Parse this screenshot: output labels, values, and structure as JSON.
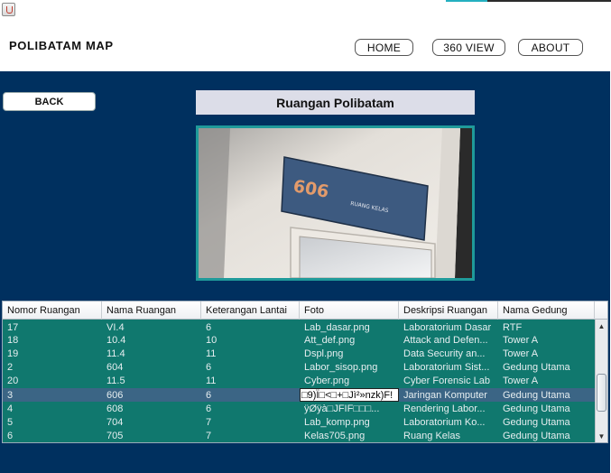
{
  "titlebar": {
    "icon": "java-cup-icon"
  },
  "header": {
    "brand": "POLIBATAM MAP",
    "nav": [
      {
        "label": "HOME"
      },
      {
        "label": "360 VIEW"
      },
      {
        "label": "ABOUT"
      }
    ]
  },
  "main": {
    "back_label": "BACK",
    "title": "Ruangan Polibatam",
    "photo": {
      "sign_number": "606",
      "sign_text": "RUANG KELAS"
    }
  },
  "table": {
    "columns": [
      "Nomor Ruangan",
      "Nama Ruangan",
      "Keterangan Lantai",
      "Foto",
      "Deskripsi Ruangan",
      "Nama Gedung"
    ],
    "rows": [
      {
        "nomor": "17",
        "nama": "VI.4",
        "lantai": "6",
        "foto": "Lab_dasar.png",
        "deskripsi": "Laboratorium Dasar",
        "gedung": "RTF"
      },
      {
        "nomor": "18",
        "nama": "10.4",
        "lantai": "10",
        "foto": "Att_def.png",
        "deskripsi": "Attack and Defen...",
        "gedung": "Tower A"
      },
      {
        "nomor": "19",
        "nama": "11.4",
        "lantai": "11",
        "foto": "Dspl.png",
        "deskripsi": "Data Security an...",
        "gedung": "Tower A"
      },
      {
        "nomor": "2",
        "nama": "604",
        "lantai": "6",
        "foto": "Labor_sisop.png",
        "deskripsi": "Laboratorium Sist...",
        "gedung": "Gedung Utama"
      },
      {
        "nomor": "20",
        "nama": "11.5",
        "lantai": "11",
        "foto": "Cyber.png",
        "deskripsi": "Cyber Forensic Lab",
        "gedung": "Tower A"
      },
      {
        "nomor": "3",
        "nama": "606",
        "lantai": "6",
        "foto": "□9)Ï□<□+□Jì²»nzk)F!",
        "deskripsi": "Jaringan Komputer",
        "gedung": "Gedung Utama"
      },
      {
        "nomor": "4",
        "nama": "608",
        "lantai": "6",
        "foto": "ÿØÿà□JFIF□□□...",
        "deskripsi": "Rendering Labor...",
        "gedung": "Gedung Utama"
      },
      {
        "nomor": "5",
        "nama": "704",
        "lantai": "7",
        "foto": "Lab_komp.png",
        "deskripsi": "Laboratorium Ko...",
        "gedung": "Gedung Utama"
      },
      {
        "nomor": "6",
        "nama": "705",
        "lantai": "7",
        "foto": "Kelas705.png",
        "deskripsi": "Ruang Kelas",
        "gedung": "Gedung Utama"
      }
    ],
    "selected_row": 5,
    "editing_row": 5
  },
  "colors": {
    "navy": "#00305f",
    "row_bg": "#10786e",
    "selected_bg": "#3b6585",
    "photo_border": "#1f9a9a",
    "sign_blue": "#3d5a80",
    "sign_number": "#e39b6b"
  }
}
